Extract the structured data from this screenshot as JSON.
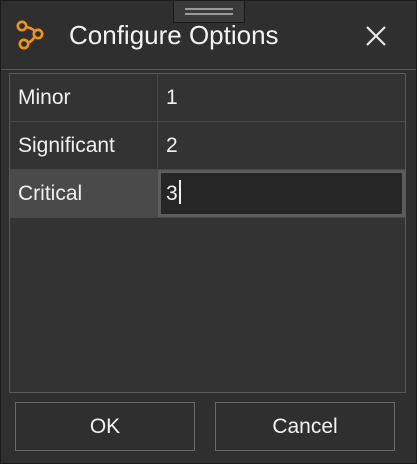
{
  "dialog": {
    "title": "Configure Options",
    "app_icon": "workflow-nodes-icon",
    "close_icon": "close-icon",
    "accent_color": "#f0931e"
  },
  "grid": {
    "rows": [
      {
        "label": "Minor",
        "value": "1"
      },
      {
        "label": "Significant",
        "value": "2"
      },
      {
        "label": "Critical",
        "value": "3"
      }
    ],
    "selected_row": 2
  },
  "buttons": {
    "ok_label": "OK",
    "cancel_label": "Cancel"
  }
}
